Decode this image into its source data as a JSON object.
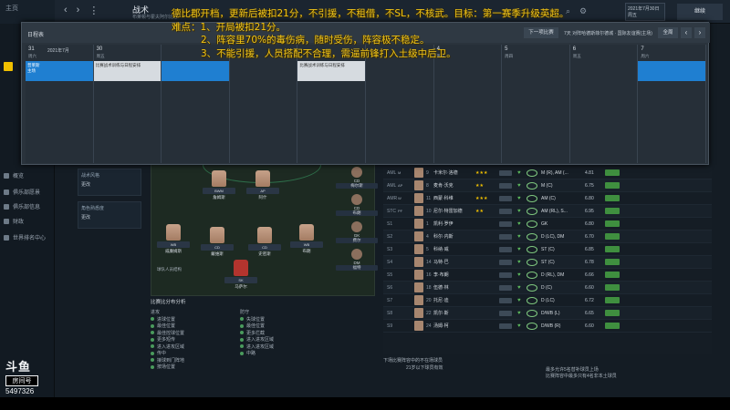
{
  "topbar": {
    "home": "主页",
    "title": "战术",
    "subtitle": "布莱顿与霍夫阿尔比恩",
    "date": "2021年7月30日 周五",
    "continue": "继续"
  },
  "sidebar": {
    "items": [
      "概览",
      "俱乐部愿景",
      "俱乐部信息",
      "财政",
      "世界排名中心"
    ]
  },
  "overlay": {
    "label": "日程表",
    "prev_btn": "下一项比赛",
    "match": "7天 对阵哈德斯菲尔德城 · 国际友谊赛(主场)",
    "week_btn": "全周",
    "days": [
      {
        "n": "31",
        "w": "周六",
        "month": "2021年7月",
        "event": "普莱斯",
        "event2": "主场",
        "style": "blue"
      },
      {
        "n": "30",
        "w": "周五",
        "month": "",
        "event": "比赛战术训练与日程安排",
        "event2": "",
        "style": "grey"
      },
      {
        "n": "",
        "w": "",
        "month": "",
        "event": "",
        "event2": "",
        "style": "blue"
      },
      {
        "n": "",
        "w": "",
        "month": "",
        "event": "",
        "event2": "",
        "style": ""
      },
      {
        "n": "",
        "w": "",
        "month": "",
        "event": "比赛战术训练与日程安排",
        "event2": "",
        "style": "grey"
      },
      {
        "n": "",
        "w": "",
        "month": "",
        "event": "",
        "event2": "",
        "style": ""
      },
      {
        "n": "4",
        "w": "周三",
        "month": "",
        "event": "",
        "event2": "",
        "style": ""
      },
      {
        "n": "5",
        "w": "周四",
        "month": "",
        "event": "",
        "event2": "",
        "style": ""
      },
      {
        "n": "6",
        "w": "周五",
        "month": "",
        "event": "",
        "event2": "",
        "style": ""
      },
      {
        "n": "7",
        "w": "周六",
        "month": "",
        "event": "",
        "event2": "",
        "style": "blue"
      }
    ]
  },
  "annotation": {
    "line1": "德比郡开档，更新后被扣21分，不引援，不租借，不SL，不核武。目标：第一赛季升级英超。",
    "line2": "难点：1、开局被扣21分。",
    "line3": "2、阵容里70%的毒伤病，随时受伤，阵容极不稳定。",
    "line4": "3、不能引援，人员搭配不合理，需逼前锋打入土级中后卫。"
  },
  "left_panel": {
    "box1": "战术风格",
    "box1_btn": "更改",
    "box2": "角色熟悉度",
    "box2_btn": "更改"
  },
  "pitch_players": [
    {
      "tag": "BWM",
      "name": "詹姆斯"
    },
    {
      "tag": "AP",
      "name": "阿什"
    },
    {
      "tag": "WB",
      "name": "威廉姆斯"
    },
    {
      "tag": "CD",
      "name": "戴维斯"
    },
    {
      "tag": "CD",
      "name": "史密斯"
    },
    {
      "tag": "WB",
      "name": "布朗"
    },
    {
      "tag": "SK",
      "name": "马萨尔"
    }
  ],
  "pitch_caption": "球队人员结构",
  "instructions": {
    "header": "比赛比分布分析",
    "left_title": "进攻",
    "right_title": "防守",
    "left": [
      "进球位置",
      "最佳位置",
      "最佳控球位置",
      "更多短传",
      "进入进攻区域",
      "传中",
      "接球到门阵地",
      "按场位置"
    ],
    "right": [
      "失球位置",
      "最佳位置",
      "更多拦截",
      "进入进攻区域",
      "进入进攻区域",
      "中路"
    ]
  },
  "bench": [
    {
      "tag": "CD",
      "name": "梅尔斯"
    },
    {
      "tag": "CD",
      "name": "布朗"
    },
    {
      "tag": "GK",
      "name": "费尔"
    },
    {
      "tag": "DM",
      "name": "福特"
    }
  ],
  "table": {
    "rows": [
      {
        "pos": "AML",
        "posd": "M",
        "shirt": "9",
        "name": "卡米尔·洛德",
        "stars": "★★★",
        "role": "M (R), AM (...",
        "num": "4.81"
      },
      {
        "pos": "AML",
        "posd": "AP",
        "shirt": "8",
        "name": "麦肯·沃克",
        "stars": "★★",
        "role": "M (C)",
        "num": "6.75"
      },
      {
        "pos": "AMR",
        "posd": "W",
        "shirt": "11",
        "name": "西蒙·科维",
        "stars": "★★★",
        "role": "AM (C)",
        "num": "6.80"
      },
      {
        "pos": "STC",
        "posd": "PF",
        "shirt": "10",
        "name": "尼尔·特雷加德",
        "stars": "★★",
        "role": "AM (RL), S...",
        "num": "6.95"
      },
      {
        "pos": "S1",
        "posd": "",
        "shirt": "1",
        "name": "凯利·罗伊",
        "stars": "",
        "role": "GK",
        "num": "6.80"
      },
      {
        "pos": "S2",
        "posd": "",
        "shirt": "4",
        "name": "科尔·内斯",
        "stars": "",
        "role": "D (LC), DM",
        "num": "6.70"
      },
      {
        "pos": "S3",
        "posd": "",
        "shirt": "5",
        "name": "科纳·威",
        "stars": "",
        "role": "ST (C)",
        "num": "6.85"
      },
      {
        "pos": "S4",
        "posd": "",
        "shirt": "14",
        "name": "马特·巴",
        "stars": "",
        "role": "ST (C)",
        "num": "6.78"
      },
      {
        "pos": "S5",
        "posd": "",
        "shirt": "16",
        "name": "李·布朗",
        "stars": "",
        "role": "D (RL), DM",
        "num": "6.66"
      },
      {
        "pos": "S6",
        "posd": "",
        "shirt": "18",
        "name": "伍德·林",
        "stars": "",
        "role": "D (C)",
        "num": "6.60"
      },
      {
        "pos": "S7",
        "posd": "",
        "shirt": "20",
        "name": "托尼·迪",
        "stars": "",
        "role": "D (LC)",
        "num": "6.72"
      },
      {
        "pos": "S8",
        "posd": "",
        "shirt": "22",
        "name": "凯尔·斯",
        "stars": "",
        "role": "D/WB (L)",
        "num": "6.65"
      },
      {
        "pos": "S9",
        "posd": "",
        "shirt": "24",
        "name": "汤姆·柯",
        "stars": "",
        "role": "D/WB (R)",
        "num": "6.60"
      }
    ]
  },
  "bottom": {
    "a": "下场比赛阵容中的不在场球员",
    "b": "21岁以下球员有效",
    "c1": "最多允许5名替补球员上场",
    "c2": "比赛阵容中最多只有4名非本土球员"
  },
  "watermark": {
    "logo": "斗鱼",
    "room": "房间号",
    "number": "5497326"
  }
}
